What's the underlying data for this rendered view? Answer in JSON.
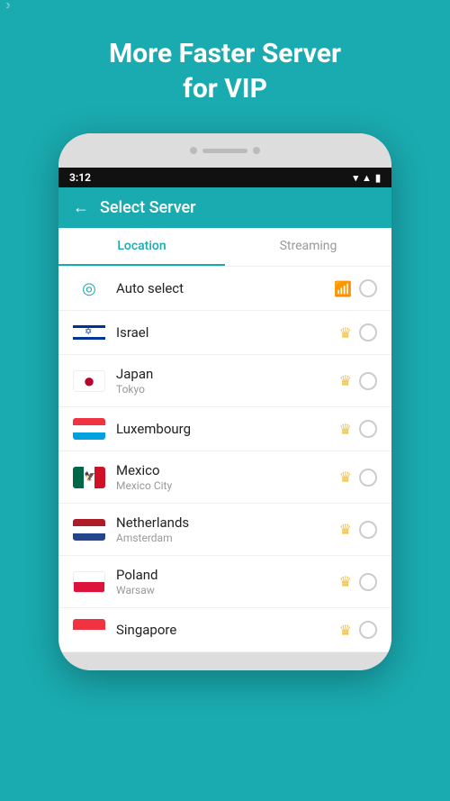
{
  "hero": {
    "line1": "More Faster Server",
    "line2": "for VIP"
  },
  "status_bar": {
    "time": "3:12",
    "icons": "▾▲◾"
  },
  "header": {
    "title": "Select Server",
    "back_label": "←"
  },
  "tabs": [
    {
      "id": "location",
      "label": "Location",
      "active": true
    },
    {
      "id": "streaming",
      "label": "Streaming",
      "active": false
    }
  ],
  "servers": [
    {
      "id": "auto",
      "name": "Auto select",
      "city": "",
      "flag_type": "auto",
      "vip": false,
      "signal": true
    },
    {
      "id": "israel",
      "name": "Israel",
      "city": "",
      "flag_type": "il",
      "vip": true,
      "signal": false
    },
    {
      "id": "japan",
      "name": "Japan",
      "city": "Tokyo",
      "flag_type": "jp",
      "vip": true,
      "signal": false
    },
    {
      "id": "luxembourg",
      "name": "Luxembourg",
      "city": "",
      "flag_type": "lu",
      "vip": true,
      "signal": false
    },
    {
      "id": "mexico",
      "name": "Mexico",
      "city": "Mexico City",
      "flag_type": "mx",
      "vip": true,
      "signal": false
    },
    {
      "id": "netherlands",
      "name": "Netherlands",
      "city": "Amsterdam",
      "flag_type": "nl",
      "vip": true,
      "signal": false
    },
    {
      "id": "poland",
      "name": "Poland",
      "city": "Warsaw",
      "flag_type": "pl",
      "vip": true,
      "signal": false
    },
    {
      "id": "singapore",
      "name": "Singapore",
      "city": "",
      "flag_type": "sg",
      "vip": true,
      "signal": false
    }
  ],
  "colors": {
    "teal": "#1aabb0",
    "crown": "#f0c040",
    "signal": "#4caf50"
  }
}
